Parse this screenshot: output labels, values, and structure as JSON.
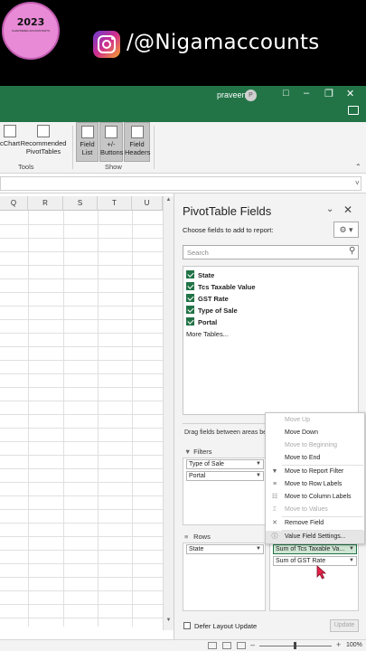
{
  "banner": {
    "logo_year": "2023",
    "logo_text": "CHARTERED ACCOUNTANTS",
    "handle": "/@Nigamaccounts"
  },
  "titlebar": {
    "user": "praveen",
    "avatar_initial": "P"
  },
  "ribbon": {
    "buttons": [
      {
        "label1": "cChart",
        "label2": ""
      },
      {
        "label1": "Recommended",
        "label2": "PivotTables"
      },
      {
        "label1": "Field",
        "label2": "List"
      },
      {
        "label1": "+/-",
        "label2": "Buttons"
      },
      {
        "label1": "Field",
        "label2": "Headers"
      }
    ],
    "groups": {
      "tools": "Tools",
      "show": "Show"
    }
  },
  "sheet": {
    "columns": [
      "Q",
      "R",
      "S",
      "T",
      "U"
    ]
  },
  "pivot": {
    "title": "PivotTable Fields",
    "choose_label": "Choose fields to add to report:",
    "search_placeholder": "Search",
    "fields": [
      {
        "name": "State",
        "checked": true
      },
      {
        "name": "Tcs Taxable Value",
        "checked": true
      },
      {
        "name": "GST Rate",
        "checked": true
      },
      {
        "name": "Type of Sale",
        "checked": true
      },
      {
        "name": "Portal",
        "checked": true
      }
    ],
    "more_tables": "More Tables...",
    "drag_text": "Drag fields between areas be",
    "filters_label": "Filters",
    "filters": [
      "Type of Sale",
      "Portal"
    ],
    "rows_label": "Rows",
    "rows": [
      "State"
    ],
    "values": [
      "Sum of Tcs Taxable Va...",
      "Sum of GST Rate"
    ],
    "defer_label": "Defer Layout Update",
    "update_label": "Update"
  },
  "context_menu": {
    "items": [
      {
        "label": "Move Up",
        "enabled": false
      },
      {
        "label": "Move Down",
        "enabled": true
      },
      {
        "label": "Move to Beginning",
        "enabled": false
      },
      {
        "label": "Move to End",
        "enabled": true
      },
      {
        "label": "Move to Report Filter",
        "enabled": true
      },
      {
        "label": "Move to Row Labels",
        "enabled": true
      },
      {
        "label": "Move to Column Labels",
        "enabled": true
      },
      {
        "label": "Move to Values",
        "enabled": false
      },
      {
        "label": "Remove Field",
        "enabled": true
      },
      {
        "label": "Value Field Settings...",
        "enabled": true
      }
    ]
  },
  "status": {
    "zoom": "100%"
  },
  "colors": {
    "excel_green": "#217346",
    "titlebar_green": "#227447"
  }
}
